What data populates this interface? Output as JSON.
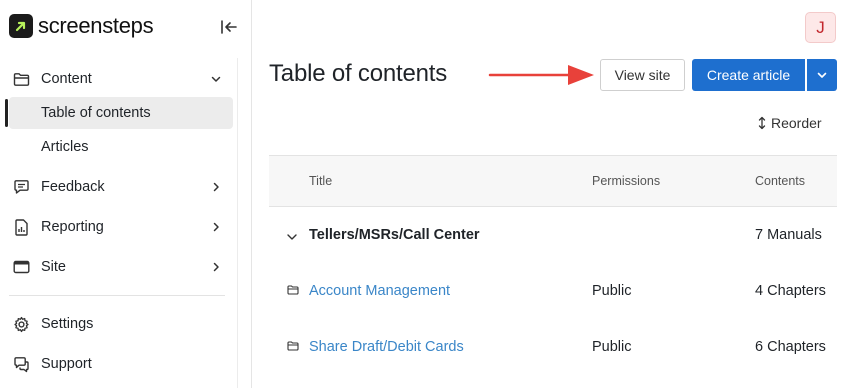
{
  "app": {
    "logo_text": "screensteps",
    "accent_color": "#1e6fcf"
  },
  "sidebar": {
    "collapse_icon": "collapse-left-icon",
    "items": [
      {
        "label": "Content",
        "icon": "folder-icon",
        "expanded": true
      },
      {
        "label": "Table of contents",
        "active": true
      },
      {
        "label": "Articles"
      },
      {
        "label": "Feedback",
        "icon": "chat-icon"
      },
      {
        "label": "Reporting",
        "icon": "report-icon"
      },
      {
        "label": "Site",
        "icon": "browser-icon"
      },
      {
        "label": "Settings",
        "icon": "gear-icon"
      },
      {
        "label": "Support",
        "icon": "support-icon"
      }
    ]
  },
  "header": {
    "avatar_initial": "J",
    "title": "Table of contents",
    "view_site_label": "View site",
    "create_article_label": "Create article",
    "reorder_label": "Reorder"
  },
  "table": {
    "columns": [
      "Title",
      "Permissions",
      "Contents"
    ],
    "rows": [
      {
        "title": "Tellers/MSRs/Call Center",
        "permissions": "",
        "contents": "7 Manuals",
        "type": "group"
      },
      {
        "title": "Account Management",
        "permissions": "Public",
        "contents": "4 Chapters",
        "type": "manual"
      },
      {
        "title": "Share Draft/Debit Cards",
        "permissions": "Public",
        "contents": "6 Chapters",
        "type": "manual"
      }
    ]
  }
}
